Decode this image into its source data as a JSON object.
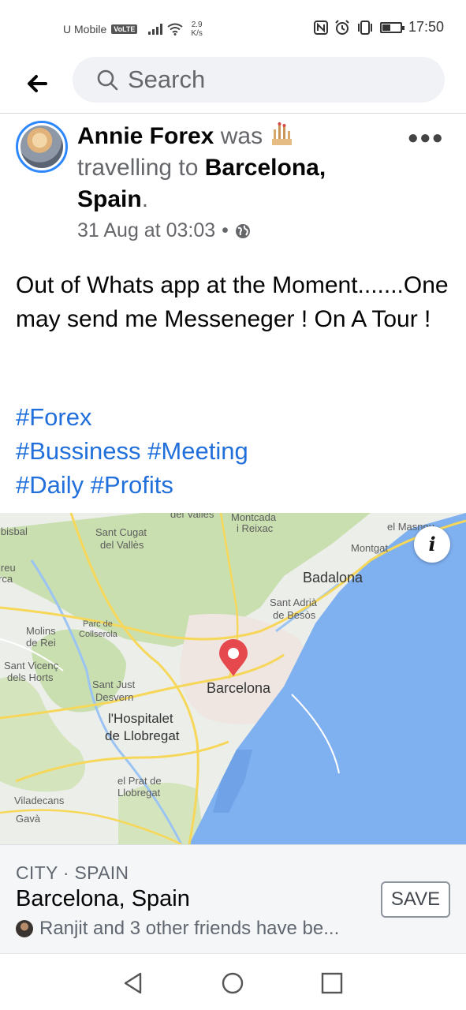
{
  "status_bar": {
    "carrier": "U Mobile",
    "volte": "VoLTE",
    "speed_value": "2.9",
    "speed_unit": "K/s",
    "time": "17:50",
    "battery_level": 0.4
  },
  "header": {
    "search_placeholder": "Search"
  },
  "post": {
    "author": "Annie Forex",
    "verb": "was",
    "activity": "travelling to",
    "place": "Barcelona, Spain",
    "timestamp": "31 Aug at 03:03",
    "separator": "•",
    "body": "Out of Whats app at the Moment.......One may send me Messeneger ! On A Tour !",
    "hashtags": [
      "#Forex",
      "#Bussiness",
      "#Meeting",
      "#Daily",
      "#Profits"
    ]
  },
  "map": {
    "labels": {
      "del_valles": "del Vallès",
      "montcada": "Montcada",
      "reixac": "i Reixac",
      "el_masnou": "el Masnou",
      "montgat": "Montgat",
      "ibisbal": "lbisbal",
      "sant_cugat_1": "Sant Cugat",
      "sant_cugat_2": "del Vallès",
      "ireu": "lreu",
      "rca": "rca",
      "badalona": "Badalona",
      "sant_adria_1": "Sant Adrià",
      "sant_adria_2": "de Besòs",
      "parc_1": "Parc de",
      "parc_2": "Collserola",
      "molins_1": "Molins",
      "molins_2": "de Rei",
      "sant_vicenc_1": "Sant Vicenç",
      "sant_vicenc_2": "dels Horts",
      "sant_just_1": "Sant Just",
      "sant_just_2": "Desvern",
      "barcelona": "Barcelona",
      "hospitalet_1": "l'Hospitalet",
      "hospitalet_2": "de Llobregat",
      "prat_1": "el Prat de",
      "prat_2": "Llobregat",
      "viladecans": "Viladecans",
      "gava": "Gavà"
    },
    "info_label": "i"
  },
  "place_card": {
    "kind": "CITY · SPAIN",
    "name": "Barcelona, Spain",
    "friends_text": "Ranjit and 3 other friends have be...",
    "save_label": "SAVE"
  },
  "colors": {
    "link_blue": "#216fdb",
    "avatar_ring": "#2d88ff",
    "pin_red": "#e5484d",
    "sea": "#7fb0f0",
    "park_green": "#c9dfb0"
  }
}
